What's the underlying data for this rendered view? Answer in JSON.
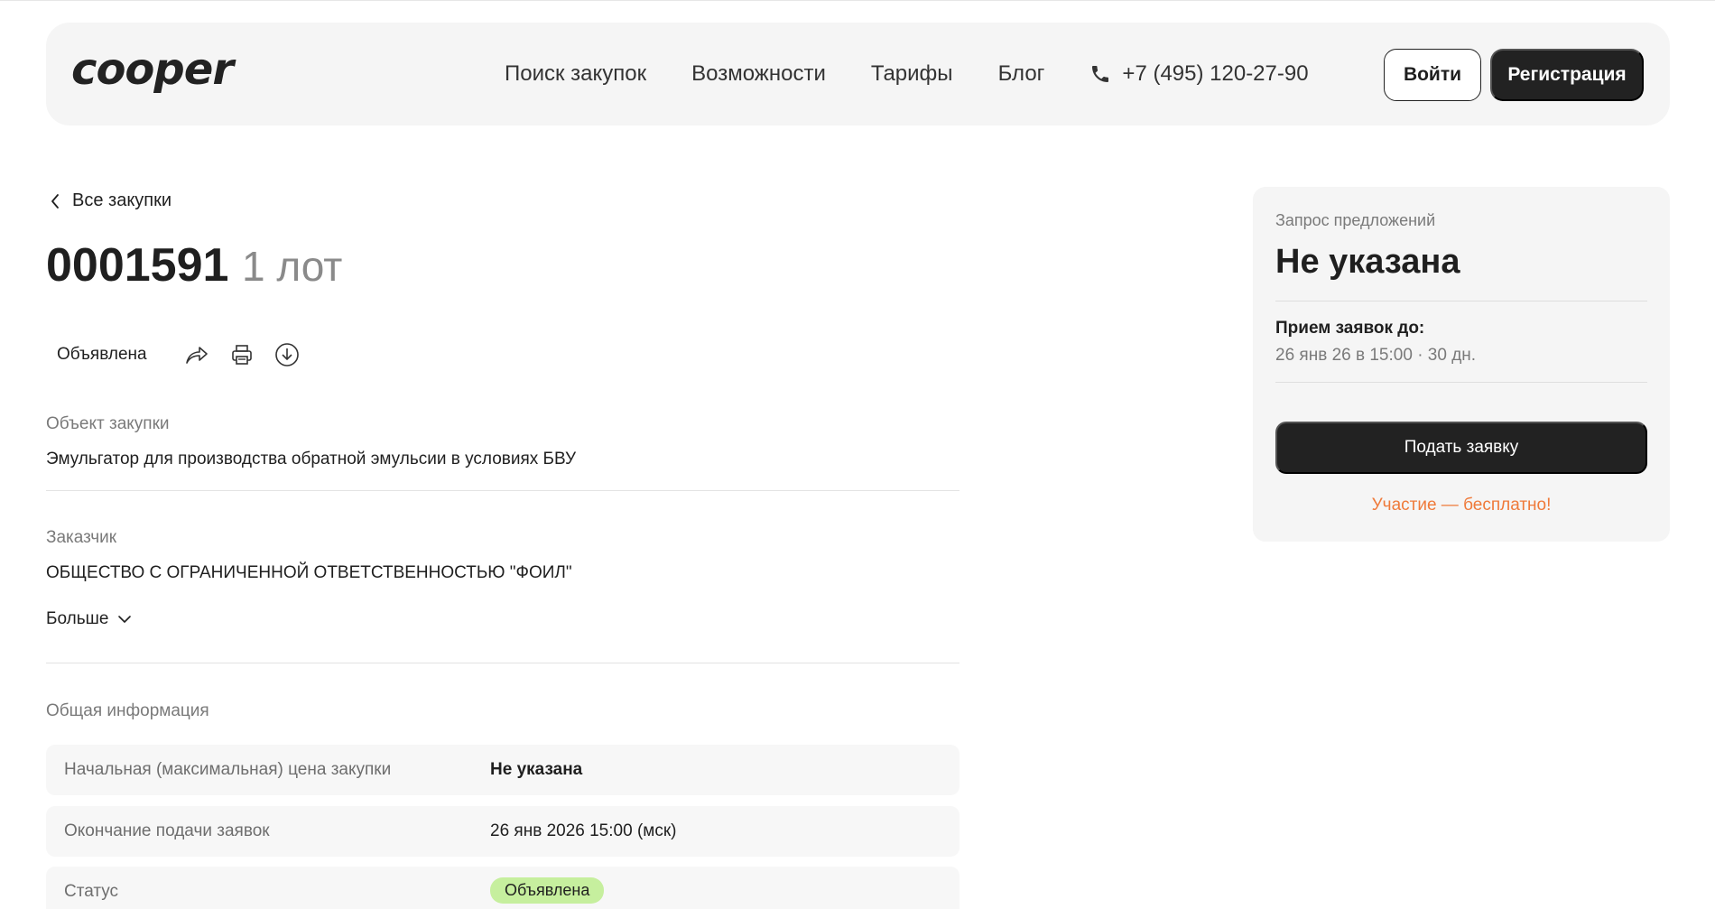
{
  "header": {
    "logo": "cooper",
    "nav": [
      {
        "label": "Поиск закупок"
      },
      {
        "label": "Возможности"
      },
      {
        "label": "Тарифы"
      },
      {
        "label": "Блог"
      }
    ],
    "phone": "+7 (495) 120-27-90",
    "login_label": "Войти",
    "register_label": "Регистрация"
  },
  "main": {
    "back_label": "Все закупки",
    "title": "0001591",
    "lots": "1 лот",
    "status_chip": "Объявлена",
    "action_icons": [
      "share-icon",
      "print-icon",
      "download-icon"
    ],
    "object": {
      "label": "Объект закупки",
      "value": "Эмульгатор для производства обратной эмульсии в условиях БВУ"
    },
    "customer": {
      "label": "Заказчик",
      "value": "ОБЩЕСТВО С ОГРАНИЧЕННОЙ ОТВЕТСТВЕННОСТЬЮ \"ФОИЛ\""
    },
    "more_label": "Больше",
    "info": {
      "title": "Общая информация",
      "rows": [
        {
          "key": "Начальная (максимальная) цена закупки",
          "value": "Не указана"
        },
        {
          "key": "Окончание подачи заявок",
          "value": "26 янв 2026 15:00 (мск)"
        },
        {
          "key": "Статус",
          "value": "Объявлена"
        }
      ]
    }
  },
  "side": {
    "type": "Запрос предложений",
    "price": "Не указана",
    "deadline_label": "Прием заявок до:",
    "deadline_value": "26 янв 26 в 15:00",
    "deadline_days": "30 дн.",
    "apply_label": "Подать заявку",
    "free_label": "Участие — бесплатно!"
  },
  "colors": {
    "dark": "#222222",
    "accent_orange": "#ef7a3a",
    "status_green": "#c6ef9e",
    "card_bg": "#f5f5f5"
  }
}
